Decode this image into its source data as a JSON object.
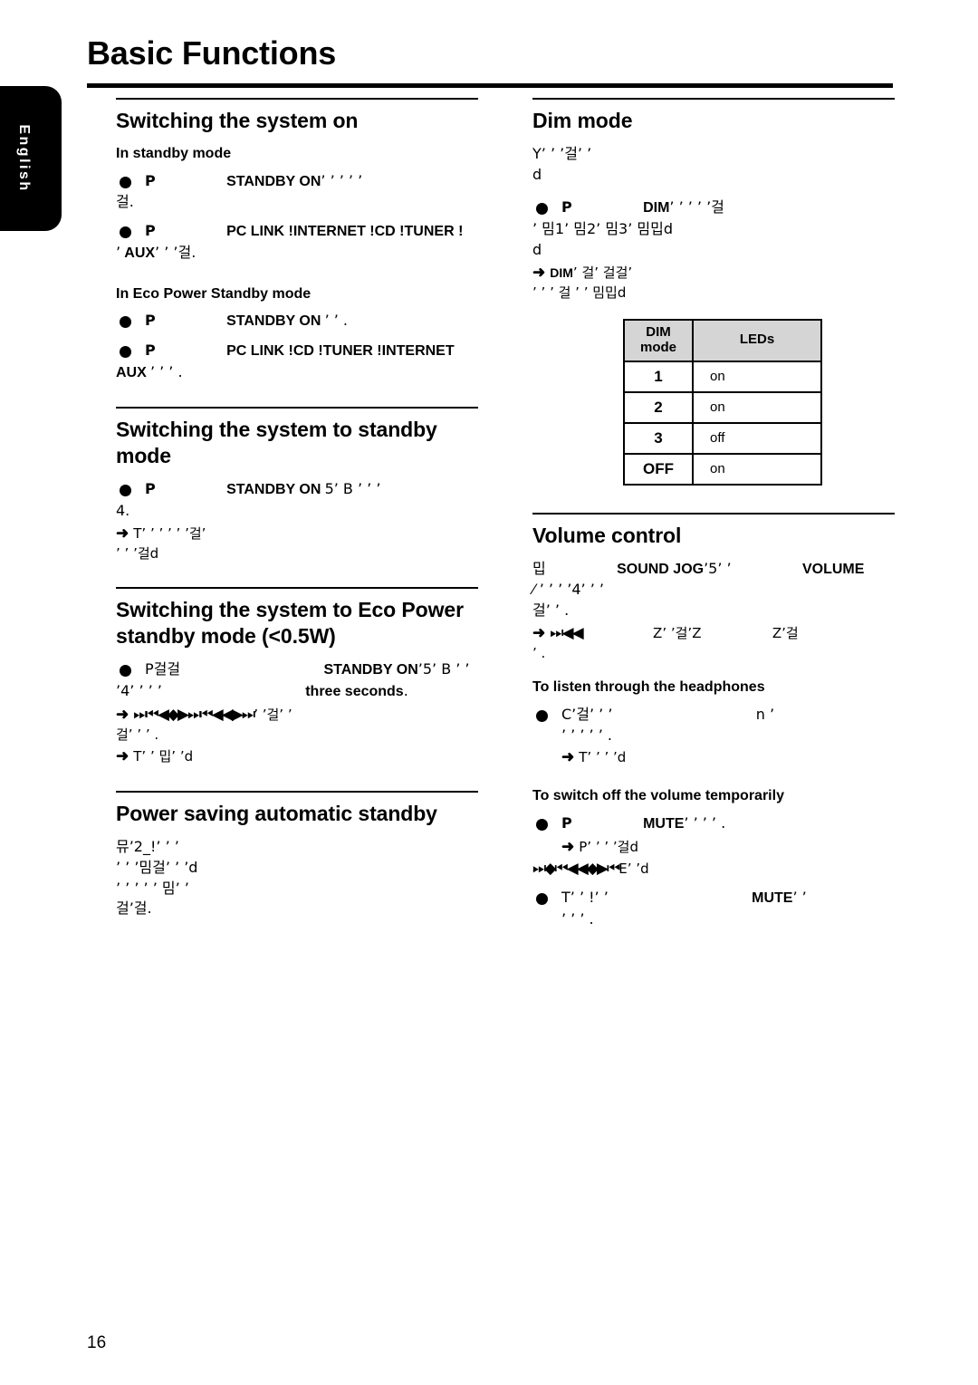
{
  "side_tab": {
    "label": "English"
  },
  "page_title": "Basic Functions",
  "page_number": "16",
  "left_column": {
    "section_switch_on": {
      "heading": "Switching the system on",
      "sub_head_standby": "In standby mode",
      "bullet1_prefix": "P",
      "bullet1_bold": "STANDBY ON",
      "bullet1_tail": "’ ’ ’ ’ ’",
      "bullet1_line2": "걸.",
      "bullet2_prefix": "P",
      "bullet2_bold": "PC LINK !INTERNET !CD !TUNER !",
      "bullet2_line2_lead": "’",
      "bullet2_line2_bold": "AUX",
      "bullet2_line2_tail": "’ ’ ’걸.",
      "sub_head_eco": "In Eco Power Standby mode",
      "bullet3_prefix": "P",
      "bullet3_bold": "STANDBY ON",
      "bullet3_tail": "’ ’ .",
      "bullet4_prefix": "P",
      "bullet4_bold": "PC LINK !CD !TUNER !INTERNET",
      "bullet4_line2_bold": "AUX",
      "bullet4_line2_tail": "’ ’ ’ ."
    },
    "section_standby": {
      "heading": "Switching the system to standby mode",
      "bullet1_prefix": "P",
      "bullet1_bold": "STANDBY ON",
      "bullet1_tail": "5’ B ’ ’ ’",
      "bullet1_line2": "4.",
      "arrow1": "➜",
      "arrow1_text": "T’ ’ ’ ’ ’ ’걸’",
      "arrow1_line2": "’ ’ ’걸d"
    },
    "section_eco": {
      "heading": "Switching the system to Eco Power standby mode (<0.5W)",
      "bullet1_prefix": "P걸걸",
      "bullet1_bold": "STANDBY ON",
      "bullet1_tail": "’5’ B ’ ’",
      "bullet1_line2_lead": "’4’ ’ ’ ’",
      "bullet1_line2_bold": "three seconds",
      "bullet1_line2_tail": ".",
      "arrow1": "➜",
      "arrow1_glyphs": "⏭⏮◀◆▶⏭⏮◀◀▶⏭",
      "arrow1_text": "’ ’걸’ ’",
      "arrow1_line2": "걸’ ’ ’ .",
      "arrow2": "➜",
      "arrow2_text": "T’ ’ 밉’ ’d"
    },
    "section_auto_standby": {
      "heading": "Power saving automatic standby",
      "line1": "뮤’2_!’ ’ ’",
      "line2": "’ ’ ’밈걸’ ’ ’d",
      "line3": "’ ’ ’ ’ ’ 밈’ ’",
      "line4": "걸’걸."
    }
  },
  "right_column": {
    "section_dim": {
      "heading": "Dim mode",
      "intro_line1": "Y’ ’ ’걸’ ’",
      "intro_line2": "d",
      "bullet1_prefix": "P",
      "bullet1_bold": "DIM",
      "bullet1_tail": "’ ’ ’ ’ ’걸",
      "bullet1_line2": "’ 밈1’ 밈2’ 밈3’ 밈밉d",
      "bullet1_line3": "d",
      "arrow1": "➜",
      "arrow1_bold": "DIM",
      "arrow1_text": "’ 걸’ 걸걸’",
      "arrow1_line2": "’ ’ ’ 걸 ’ ’ 밈밉d",
      "table": {
        "headers": [
          "DIM mode",
          "LEDs"
        ],
        "header_col1_line1": "DIM",
        "header_col1_line2": "mode",
        "header_col2": "LEDs",
        "rows": [
          {
            "mode": "1",
            "leds": "on"
          },
          {
            "mode": "2",
            "leds": "on"
          },
          {
            "mode": "3",
            "leds": "off"
          },
          {
            "mode": "OFF",
            "leds": "on"
          }
        ]
      }
    },
    "section_volume": {
      "heading": "Volume control",
      "bullet1_prefix": "밉",
      "bullet1_bold1": "SOUND JOG",
      "bullet1_mid": "’5’ ’",
      "bullet1_bold2": "VOLUME",
      "bullet1_line2": "⁄   ’ ’ ’ ’4’ ’ ’",
      "bullet1_line3": "걸’ ’ .",
      "arrow1": "➜",
      "arrow1_glyphs": "⏭◀◀",
      "arrow1_text": "Z’ ’걸’Z",
      "arrow1_text2": "Z’걸",
      "arrow1_line2": "’ .",
      "sub_head_headphones": "To listen through the headphones",
      "hp_bullet_prefix": "C’걸’ ’ ’",
      "hp_bullet_tail": "n  ’",
      "hp_line2": "’ ’ ’ ’ ’ .",
      "hp_arrow": "➜",
      "hp_arrow_text": "T’ ’ ’ ’d",
      "sub_head_mute": "To switch off the volume temporarily",
      "mute_bullet1_prefix": "P",
      "mute_bullet1_bold": "MUTE",
      "mute_bullet1_tail": "’ ’ ’ ’ .",
      "mute_arrow1": "➜",
      "mute_arrow1_text": "P’ ’ ’ ’걸d",
      "mute_arrow1_line2_glyphs": "⏭◆⏮◀◀◆▶⏮",
      "mute_arrow1_line2_text": "E’ ’d",
      "mute_bullet2_prefix": "T’ ’ !’ ’",
      "mute_bullet2_bold": "MUTE",
      "mute_bullet2_tail": "’ ’",
      "mute_bullet2_line2": "’ ’ ’ ."
    }
  }
}
